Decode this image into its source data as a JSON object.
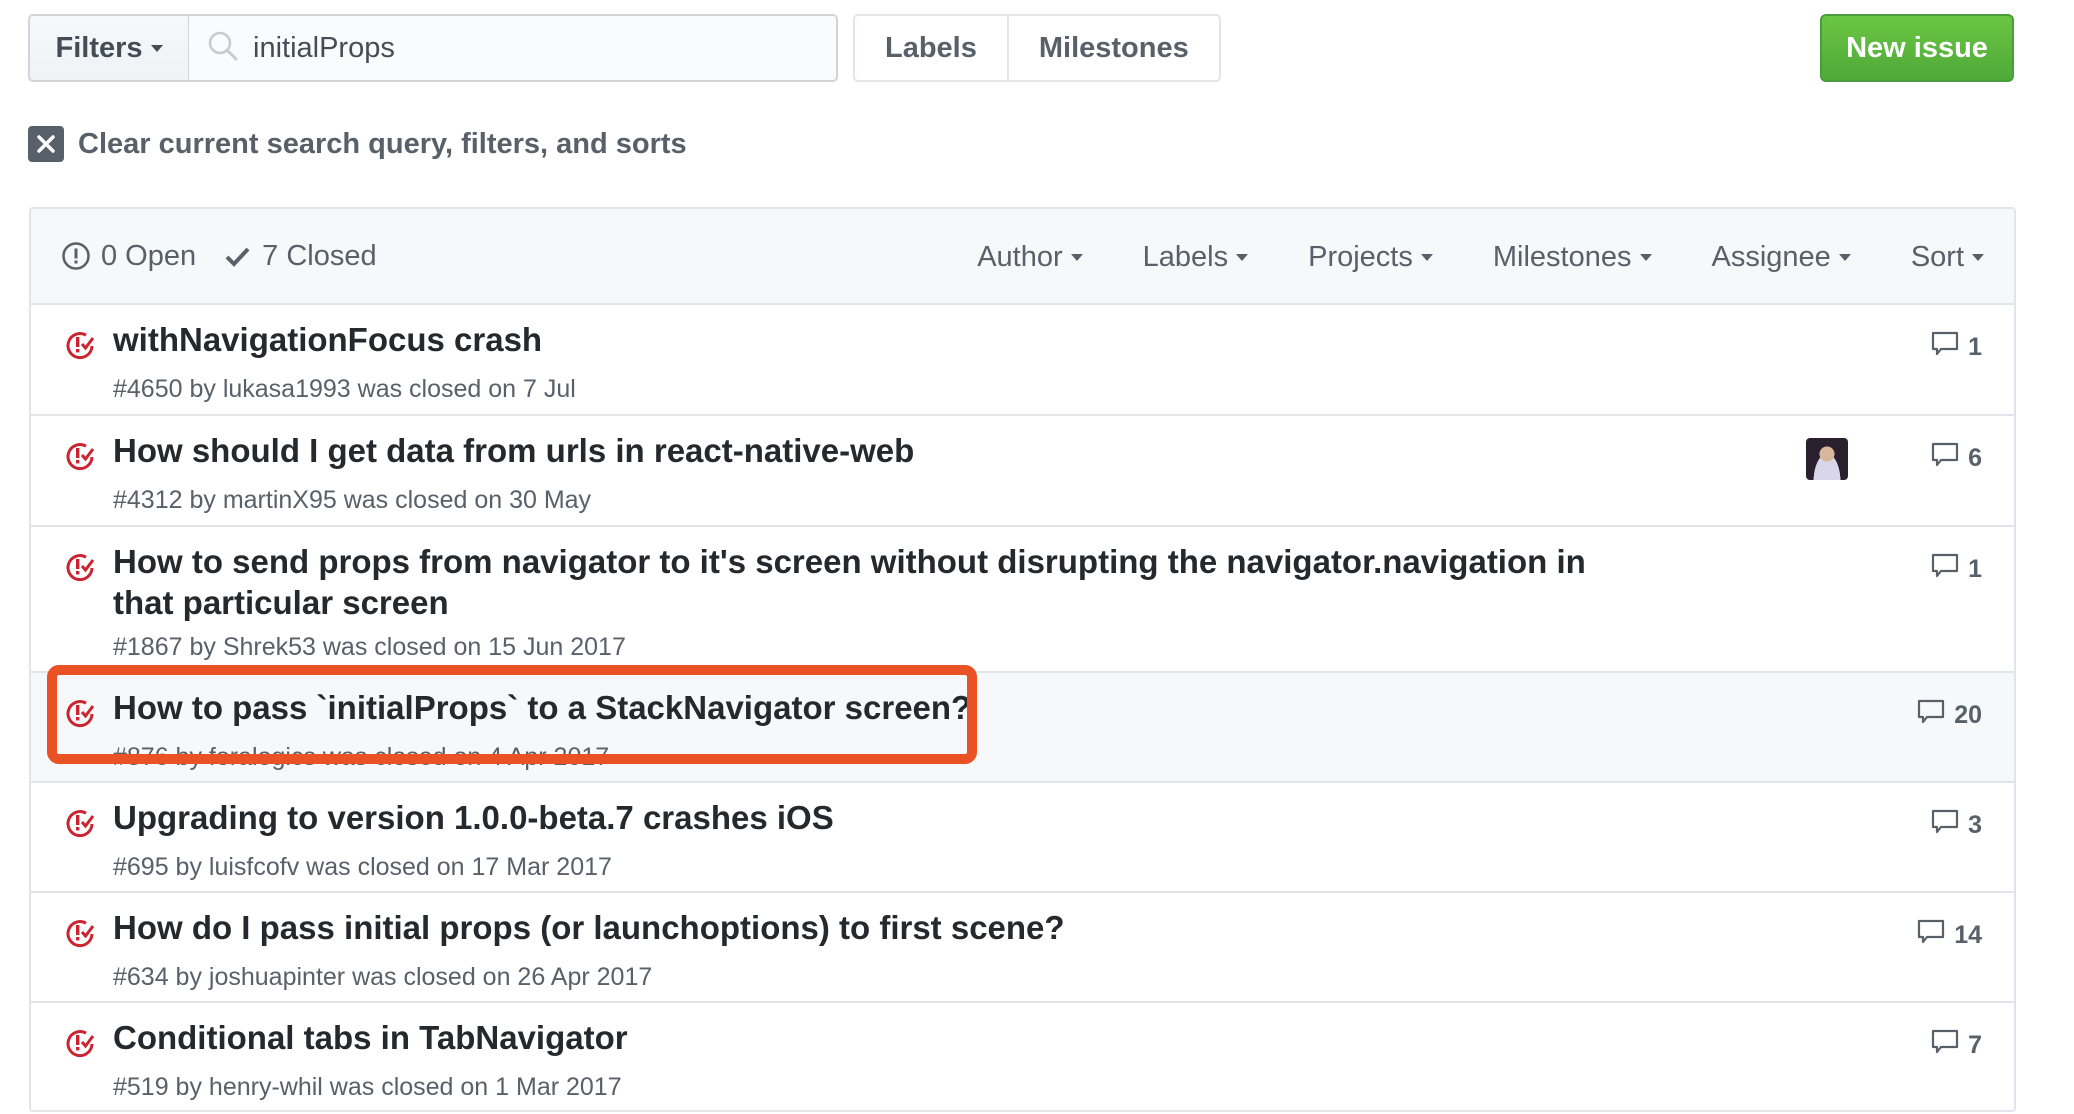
{
  "toolbar": {
    "filters_label": "Filters",
    "search_value": "initialProps",
    "search_icon": "search-icon",
    "labels_label": "Labels",
    "milestones_label": "Milestones",
    "new_issue_label": "New issue",
    "new_issue_color": "#5cb848"
  },
  "clear_query": {
    "icon": "x-icon",
    "label": "Clear current search query, filters, and sorts"
  },
  "list_header": {
    "open_label": "0 Open",
    "closed_label": "7 Closed",
    "filters": [
      "Author",
      "Labels",
      "Projects",
      "Milestones",
      "Assignee",
      "Sort"
    ]
  },
  "issues": [
    {
      "title": "withNavigationFocus crash",
      "meta": "#4650 by lukasa1993 was closed on 7 Jul",
      "comments": "1",
      "avatar": false
    },
    {
      "title": "How should I get data from urls in react-native-web",
      "meta": "#4312 by martinX95 was closed on 30 May",
      "comments": "6",
      "avatar": true
    },
    {
      "title": "How to send props from navigator to it's screen without disrupting the navigator.navigation in that particular screen",
      "meta": "#1867 by Shrek53 was closed on 15 Jun 2017",
      "comments": "1",
      "avatar": false
    },
    {
      "title": "How to pass `initialProps` to a StackNavigator screen?",
      "meta": "#876 by foralogics was closed on 4 Apr 2017",
      "comments": "20",
      "avatar": false,
      "highlighted": true
    },
    {
      "title": "Upgrading to version 1.0.0-beta.7 crashes iOS",
      "meta": "#695 by luisfcofv was closed on 17 Mar 2017",
      "comments": "3",
      "avatar": false
    },
    {
      "title": "How do I pass initial props (or launchoptions) to first scene?",
      "meta": "#634 by joshuapinter was closed on 26 Apr 2017",
      "comments": "14",
      "avatar": false
    },
    {
      "title": "Conditional tabs in TabNavigator",
      "meta": "#519 by henry-whil was closed on 1 Mar 2017",
      "comments": "7",
      "avatar": false
    }
  ],
  "colors": {
    "closed_icon": "#cb2431",
    "highlight_annotation": "#ea5124"
  }
}
